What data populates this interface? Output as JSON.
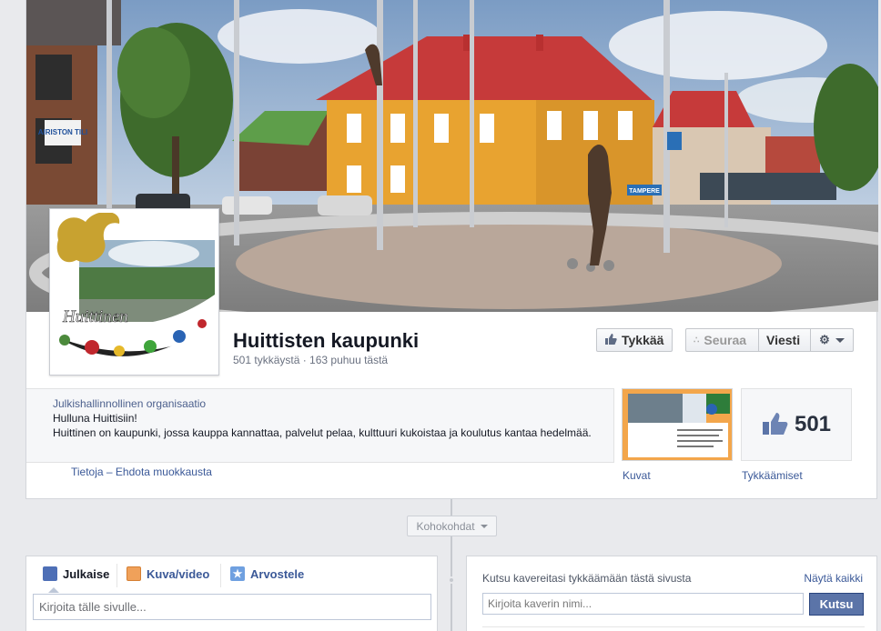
{
  "page": {
    "name": "Huittisten kaupunki",
    "stats": "501 tykkäystä · 163 puhuu tästä"
  },
  "profile": {
    "wordmark": "Huittinen"
  },
  "cover": {
    "sign_left": "AIRISTON TILI",
    "sign_road": "TAMPERE"
  },
  "actions": {
    "like_label": "Tykkää",
    "follow_label": "Seuraa",
    "message_label": "Viesti"
  },
  "about": {
    "category": "Julkishallinnollinen organisaatio",
    "tagline": "Hulluna Huittisiin!",
    "description": "Huittinen on kaupunki, jossa kauppa kannattaa, palvelut pelaa, kulttuuri kukoistaa ja koulutus kantaa hedelmää.",
    "links": "Tietoja – Ehdota muokkausta"
  },
  "tiles": {
    "photos_label": "Kuvat",
    "likes_count": "501",
    "likes_label": "Tykkäämiset"
  },
  "timeline": {
    "highlights_label": "Kohokohdat"
  },
  "composer": {
    "tabs": [
      {
        "label": "Julkaise",
        "icon": "pencil-icon"
      },
      {
        "label": "Kuva/video",
        "icon": "photo-icon"
      },
      {
        "label": "Arvostele",
        "icon": "star-icon"
      }
    ],
    "placeholder": "Kirjoita tälle sivulle..."
  },
  "invite": {
    "title": "Kutsu kavereitasi tykkäämään tästä sivusta",
    "see_all": "Näytä kaikki",
    "placeholder": "Kirjoita kaverin nimi...",
    "button_label": "Kutsu"
  },
  "colors": {
    "link": "#3b5998",
    "background": "#e9eaed",
    "invite_button": "#5b74a8"
  }
}
